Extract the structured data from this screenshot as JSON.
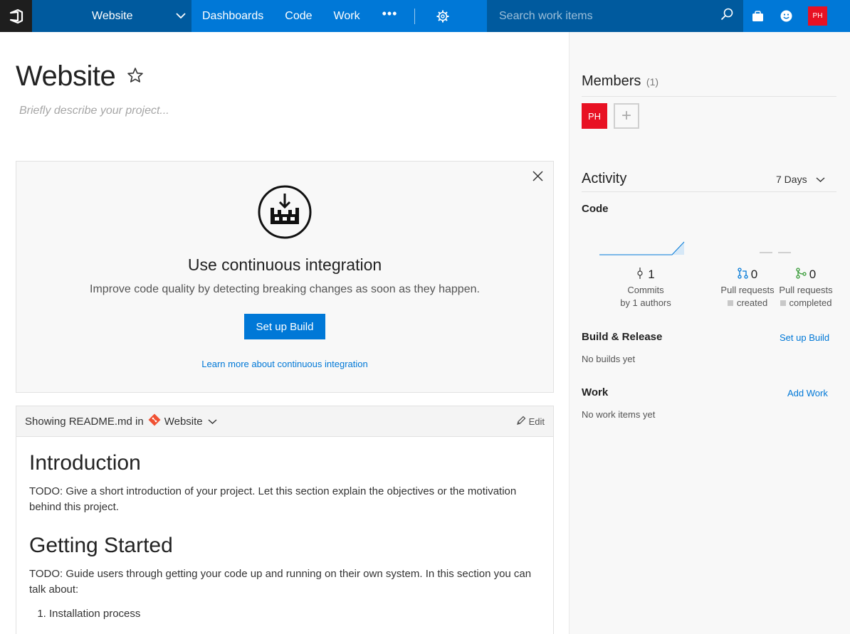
{
  "topbar": {
    "project": "Website",
    "nav": [
      "Dashboards",
      "Code",
      "Work"
    ],
    "more": "•••",
    "search_placeholder": "Search work items",
    "user_initials": "PH"
  },
  "main": {
    "title": "Website",
    "description": "Briefly describe your project...",
    "ci": {
      "title": "Use continuous integration",
      "subtitle": "Improve code quality by detecting breaking changes as soon as they happen.",
      "button": "Set up Build",
      "link": "Learn more about continuous integration"
    },
    "readme": {
      "showing": "Showing README.md in",
      "repo": "Website",
      "edit": "Edit",
      "h1": "Introduction",
      "p1": "TODO: Give a short introduction of your project. Let this section explain the objectives or the motivation behind this project.",
      "h2": "Getting Started",
      "p2": "TODO: Guide users through getting your code up and running on their own system. In this section you can talk about:",
      "list": [
        "Installation process"
      ]
    }
  },
  "side": {
    "members_title": "Members",
    "members_count": "(1)",
    "member_initials": "PH",
    "add_symbol": "+",
    "activity_title": "Activity",
    "activity_range": "7 Days",
    "code_title": "Code",
    "commits_value": "1",
    "commits_label": "Commits",
    "commits_authors": "by 1 authors",
    "pr_created_value": "0",
    "pr_created_label": "Pull requests",
    "pr_created_status": "created",
    "pr_completed_value": "0",
    "pr_completed_label": "Pull requests",
    "pr_completed_status": "completed",
    "build_title": "Build & Release",
    "build_link": "Set up Build",
    "build_empty": "No builds yet",
    "work_title": "Work",
    "work_link": "Add Work",
    "work_empty": "No work items yet"
  },
  "colors": {
    "accent": "#0078d7",
    "header_dark": "#005a9e",
    "avatar": "#e81123",
    "git": "#f05133"
  }
}
